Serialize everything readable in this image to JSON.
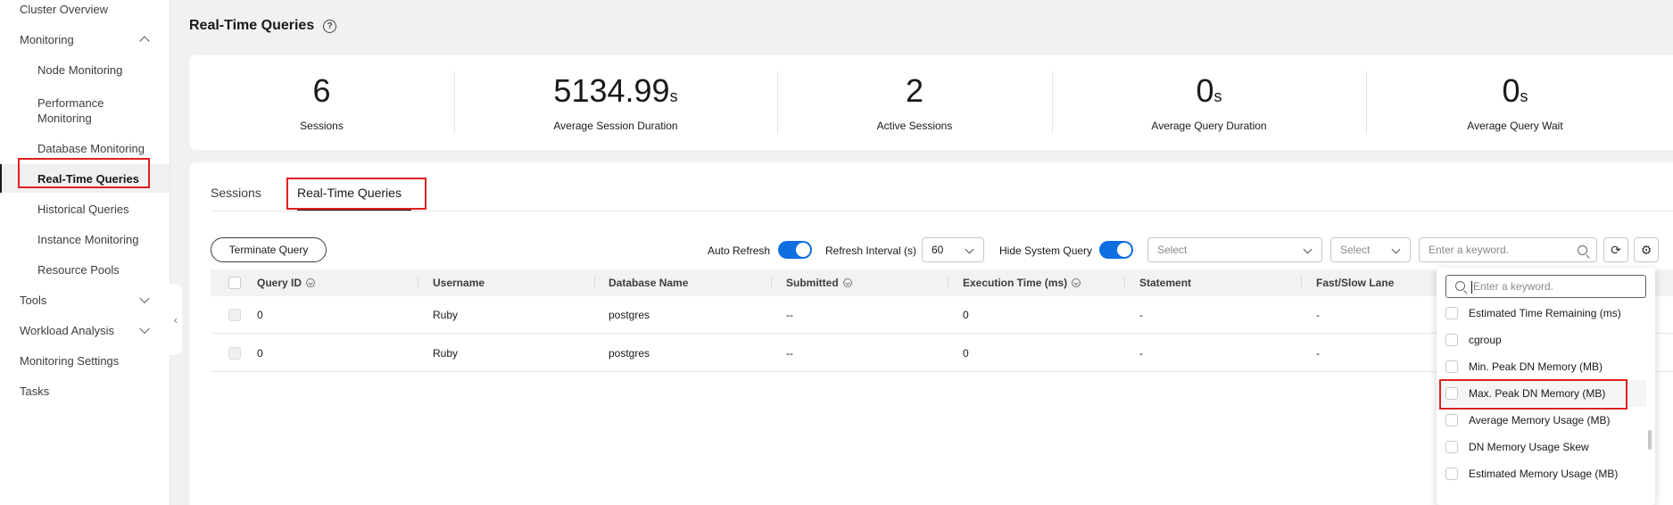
{
  "sidebar": {
    "items": [
      {
        "label": "Cluster Overview"
      },
      {
        "label": "Monitoring"
      },
      {
        "label": "Node Monitoring"
      },
      {
        "label": "Performance Monitoring"
      },
      {
        "label": "Database Monitoring"
      },
      {
        "label": "Real-Time Queries"
      },
      {
        "label": "Historical Queries"
      },
      {
        "label": "Instance Monitoring"
      },
      {
        "label": "Resource Pools"
      },
      {
        "label": "Tools"
      },
      {
        "label": "Workload Analysis"
      },
      {
        "label": "Monitoring Settings"
      },
      {
        "label": "Tasks"
      }
    ],
    "collapse_glyph": "‹"
  },
  "header": {
    "title": "Real-Time Queries",
    "help_glyph": "?"
  },
  "stats": [
    {
      "value": "6",
      "unit": "",
      "label": "Sessions"
    },
    {
      "value": "5134.99",
      "unit": "s",
      "label": "Average Session Duration"
    },
    {
      "value": "2",
      "unit": "",
      "label": "Active Sessions"
    },
    {
      "value": "0",
      "unit": "s",
      "label": "Average Query Duration"
    },
    {
      "value": "0",
      "unit": "s",
      "label": "Average Query Wait"
    }
  ],
  "tabs": [
    {
      "label": "Sessions"
    },
    {
      "label": "Real-Time Queries"
    }
  ],
  "toolbar": {
    "terminate_label": "Terminate Query",
    "auto_refresh_label": "Auto Refresh",
    "auto_refresh_on": true,
    "refresh_interval_label": "Refresh Interval (s)",
    "refresh_interval_value": "60",
    "hide_system_label": "Hide System Query",
    "hide_system_on": true,
    "select1_placeholder": "Select",
    "select2_placeholder": "Select",
    "search_placeholder": "Enter a keyword.",
    "refresh_glyph": "⟳",
    "settings_glyph": "⚙"
  },
  "table": {
    "columns": [
      "Query ID",
      "Username",
      "Database Name",
      "Submitted",
      "Execution Time (ms)",
      "Statement",
      "Fast/Slow Lane"
    ],
    "rows": [
      [
        "0",
        "Ruby",
        "postgres",
        "--",
        "0",
        "-",
        "-"
      ],
      [
        "0",
        "Ruby",
        "postgres",
        "--",
        "0",
        "-",
        "-"
      ]
    ]
  },
  "column_picker": {
    "search_placeholder": "Enter a keyword.",
    "items": [
      {
        "label": "Estimated Time Remaining (ms)",
        "checked": false
      },
      {
        "label": "cgroup",
        "checked": false
      },
      {
        "label": "Min. Peak DN Memory (MB)",
        "checked": false
      },
      {
        "label": "Max. Peak DN Memory (MB)",
        "checked": false
      },
      {
        "label": "Average Memory Usage (MB)",
        "checked": false
      },
      {
        "label": "DN Memory Usage Skew",
        "checked": false
      },
      {
        "label": "Estimated Memory Usage (MB)",
        "checked": false
      }
    ]
  },
  "colors": {
    "accent": "#0e6fe0",
    "highlight_border": "#e02020"
  }
}
